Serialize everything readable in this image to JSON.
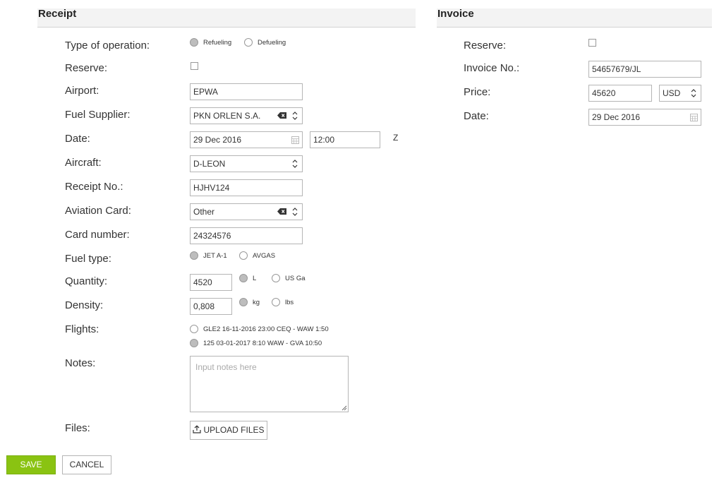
{
  "receipt": {
    "title": "Receipt",
    "type_of_operation": {
      "label": "Type of operation:",
      "options": [
        "Refueling",
        "Defueling"
      ],
      "selected": "Refueling"
    },
    "reserve": {
      "label": "Reserve:",
      "checked": false
    },
    "airport": {
      "label": "Airport:",
      "value": "EPWA"
    },
    "fuel_supplier": {
      "label": "Fuel Supplier:",
      "value": "PKN ORLEN S.A."
    },
    "date": {
      "label": "Date:",
      "value": "29 Dec 2016",
      "time": "12:00",
      "tz": "Z"
    },
    "aircraft": {
      "label": "Aircraft:",
      "value": "D-LEON"
    },
    "receipt_no": {
      "label": "Receipt No.:",
      "value": "HJHV124"
    },
    "aviation_card": {
      "label": "Aviation Card:",
      "value": "Other"
    },
    "card_number": {
      "label": "Card number:",
      "value": "24324576"
    },
    "fuel_type": {
      "label": "Fuel type:",
      "options": [
        "JET A-1",
        "AVGAS"
      ],
      "selected": "JET A-1"
    },
    "quantity": {
      "label": "Quantity:",
      "value": "4520",
      "units": [
        "L",
        "US Ga"
      ],
      "selected": "L"
    },
    "density": {
      "label": "Density:",
      "value": "0,808",
      "units": [
        "kg",
        "lbs"
      ],
      "selected": "kg"
    },
    "flights": {
      "label": "Flights:",
      "options": [
        "GLE2 16-11-2016 23:00 CEQ - WAW 1:50",
        "125 03-01-2017 8:10 WAW - GVA 10:50"
      ],
      "selected": "125 03-01-2017 8:10 WAW - GVA 10:50"
    },
    "notes": {
      "label": "Notes:",
      "placeholder": "Input notes here"
    },
    "files": {
      "label": "Files:",
      "button": "UPLOAD FILES"
    }
  },
  "invoice": {
    "title": "Invoice",
    "reserve": {
      "label": "Reserve:",
      "checked": false
    },
    "invoice_no": {
      "label": "Invoice No.:",
      "value": "54657679/JL"
    },
    "price": {
      "label": "Price:",
      "value": "45620",
      "currency": "USD"
    },
    "date": {
      "label": "Date:",
      "value": "29 Dec 2016"
    }
  },
  "actions": {
    "save": "SAVE",
    "cancel": "CANCEL"
  },
  "colors": {
    "save_button": "#8ac312",
    "radio_selected": "#bdbdbd",
    "section_header_bg": "#f3f3f3"
  },
  "icons": [
    "clear-input-icon",
    "chevron-updown-icon",
    "calendar-icon",
    "upload-icon",
    "resize-grip-icon"
  ]
}
